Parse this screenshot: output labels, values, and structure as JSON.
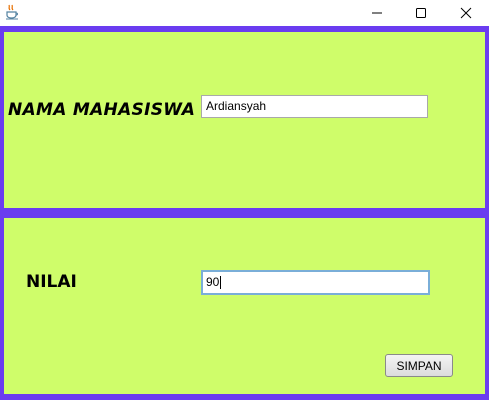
{
  "titlebar": {
    "icons": {
      "app": "java-cup-icon",
      "minimize": "minimize-icon",
      "maximize": "maximize-icon",
      "close": "close-icon"
    }
  },
  "form": {
    "nama_label": "NAMA MAHASISWA",
    "nama_value": "Ardiansyah",
    "nilai_label": "NILAI",
    "nilai_value": "90",
    "save_label": "SIMPAN"
  },
  "colors": {
    "border": "#6a3cf0",
    "panel": "#cffd6a",
    "focus": "#7aaed8"
  }
}
